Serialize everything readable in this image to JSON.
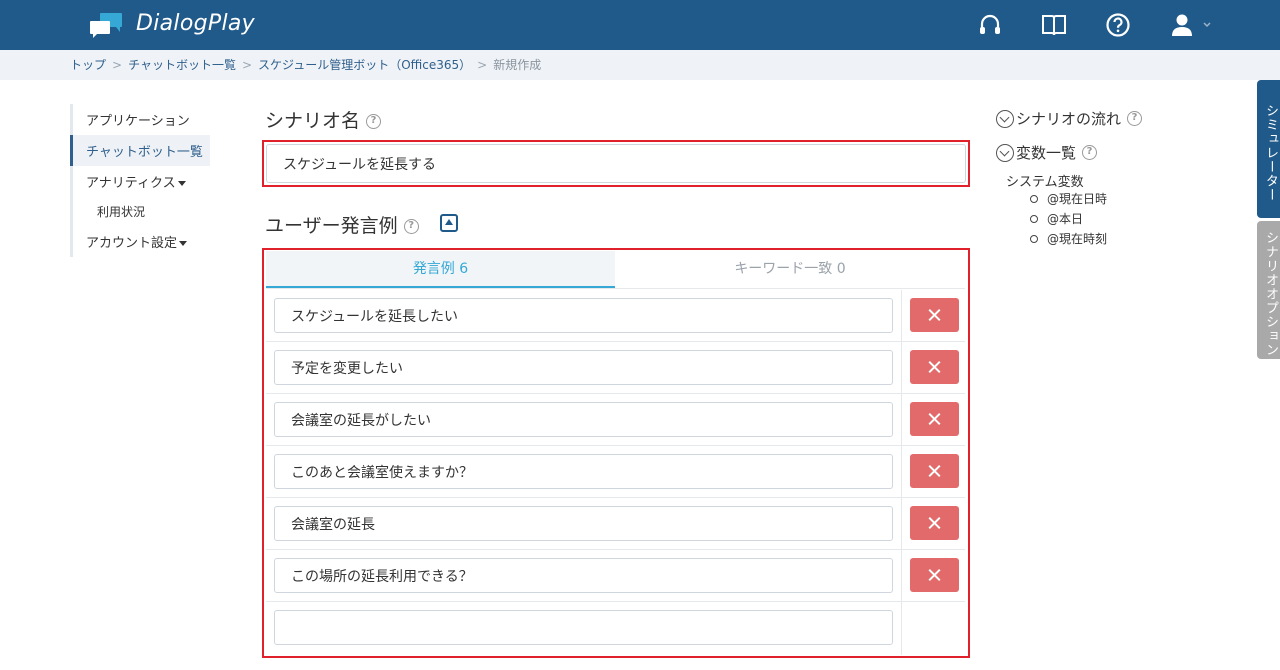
{
  "header": {
    "brand": "DialogPlay",
    "icons": [
      "headset-icon",
      "book-icon",
      "help-icon",
      "user-icon"
    ]
  },
  "breadcrumb": {
    "items": [
      "トップ",
      "チャットボット一覧",
      "スケジュール管理ボット（Office365）"
    ],
    "current": "新規作成",
    "separator": ">"
  },
  "sidebar": {
    "items": [
      {
        "label": "アプリケーション"
      },
      {
        "label": "チャットボット一覧"
      },
      {
        "label": "アナリティクス"
      },
      {
        "label": "利用状況"
      },
      {
        "label": "アカウント設定"
      }
    ]
  },
  "scenario": {
    "title": "シナリオ名",
    "help": "?",
    "value": "スケジュールを延長する"
  },
  "utterances": {
    "title": "ユーザー発言例",
    "help": "?",
    "tabs": [
      {
        "label": "発言例 6",
        "active": true
      },
      {
        "label": "キーワード一致 0",
        "active": false
      }
    ],
    "items": [
      "スケジュールを延長したい",
      "予定を変更したい",
      "会議室の延長がしたい",
      "このあと会議室使えますか？",
      "会議室の延長",
      "この場所の延長利用できる？"
    ],
    "new_value": ""
  },
  "right_panel": {
    "flow": "シナリオの流れ",
    "variables": "変数一覧",
    "help": "?",
    "system_vars_title": "システム変数",
    "system_vars": [
      "@現在日時",
      "@本日",
      "@現在時刻"
    ]
  },
  "side_tabs": {
    "simulator": "シミュレーター",
    "options": "シナリオオプション"
  },
  "colors": {
    "header_bg": "#1f5a8a",
    "highlight": "#e0202a",
    "delete": "#e26a6a",
    "active_tab": "#35a8d6"
  }
}
